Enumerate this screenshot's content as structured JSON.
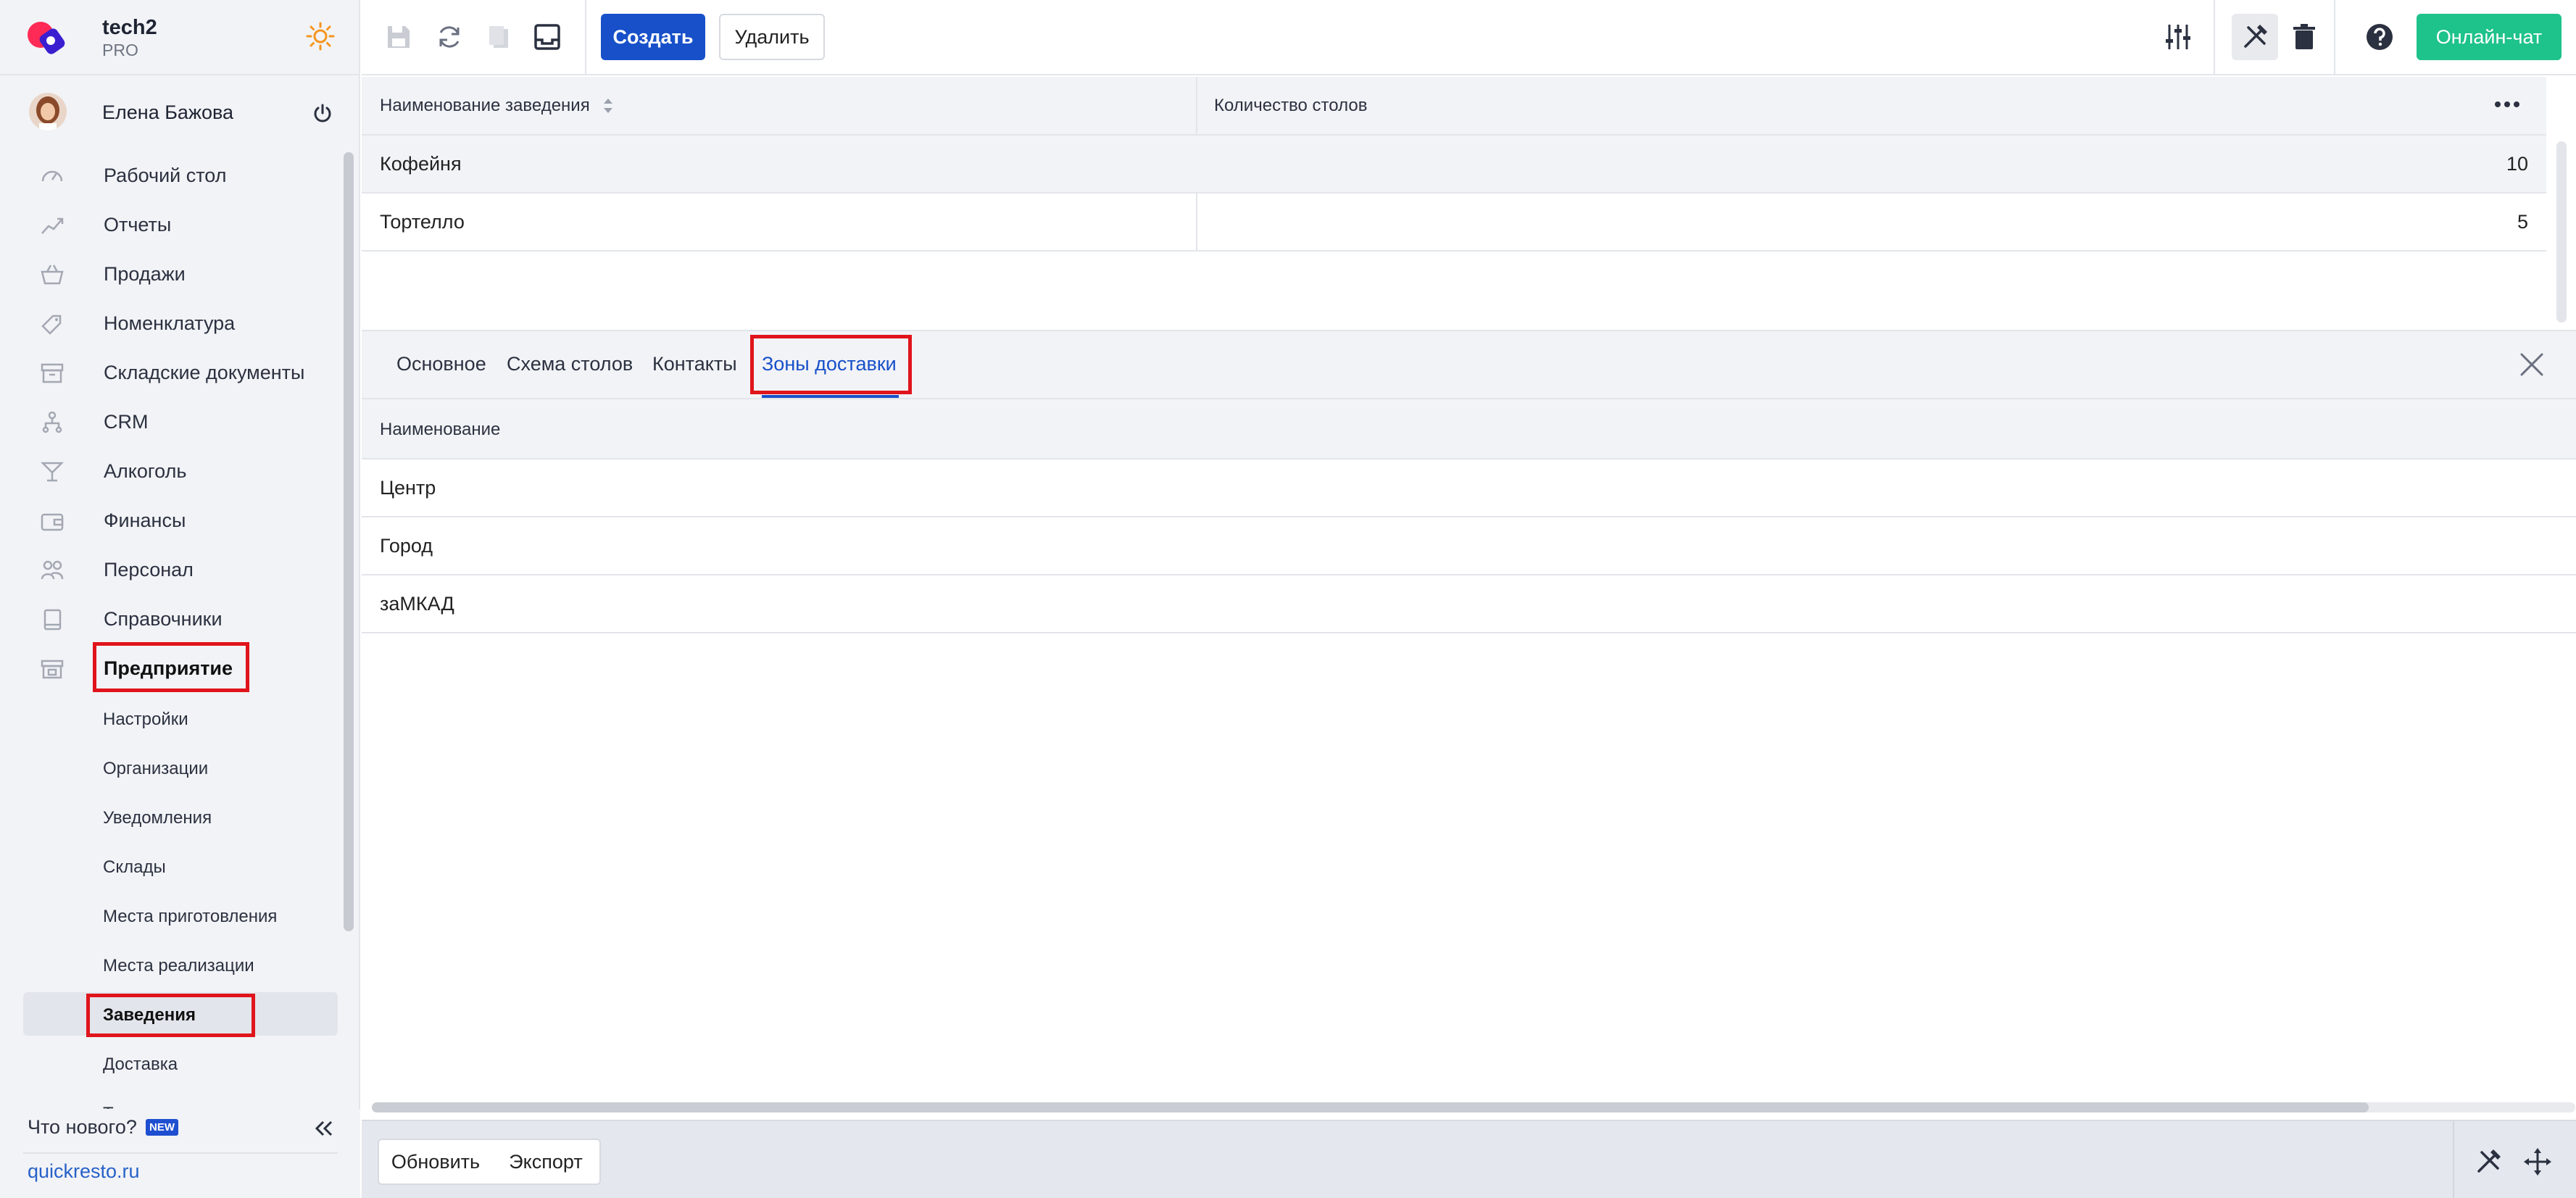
{
  "app": {
    "name": "tech2",
    "plan": "PRO",
    "user_name": "Елена Бажова"
  },
  "sidebar": {
    "items": [
      {
        "label": "Рабочий стол",
        "icon": "speedometer-icon"
      },
      {
        "label": "Отчеты",
        "icon": "chart-line-icon"
      },
      {
        "label": "Продажи",
        "icon": "basket-icon"
      },
      {
        "label": "Номенклатура",
        "icon": "tag-icon"
      },
      {
        "label": "Складские документы",
        "icon": "archive-box-icon"
      },
      {
        "label": "CRM",
        "icon": "people-hierarchy-icon"
      },
      {
        "label": "Алкоголь",
        "icon": "cocktail-glass-icon"
      },
      {
        "label": "Финансы",
        "icon": "wallet-icon"
      },
      {
        "label": "Персонал",
        "icon": "staff-icon"
      },
      {
        "label": "Справочники",
        "icon": "book-icon"
      },
      {
        "label": "Предприятие",
        "icon": "storefront-icon",
        "expanded": true
      }
    ],
    "subitems": [
      {
        "label": "Настройки"
      },
      {
        "label": "Организации"
      },
      {
        "label": "Уведомления"
      },
      {
        "label": "Склады"
      },
      {
        "label": "Места приготовления"
      },
      {
        "label": "Места реализации"
      },
      {
        "label": "Заведения",
        "selected": true
      },
      {
        "label": "Доставка"
      },
      {
        "label": "Терминалы"
      }
    ],
    "whats_new": "Что нового?",
    "new_badge": "NEW",
    "site_link": "quickresto.ru"
  },
  "toolbar": {
    "create_label": "Создать",
    "delete_label": "Удалить",
    "chat_label": "Онлайн-чат"
  },
  "main_table": {
    "columns": [
      "Наименование заведения",
      "Количество столов"
    ],
    "rows": [
      {
        "name": "Кофейня",
        "tables": "10"
      },
      {
        "name": "Тортелло",
        "tables": "5"
      }
    ]
  },
  "detail": {
    "tabs": [
      "Основное",
      "Схема столов",
      "Контакты",
      "Зоны доставки"
    ],
    "active_tab": "Зоны доставки",
    "column": "Наименование",
    "rows": [
      "Центр",
      "Город",
      "заМКАД"
    ]
  },
  "footer": {
    "refresh_label": "Обновить",
    "export_label": "Экспорт"
  },
  "colors": {
    "accent": "#1750c9",
    "chat": "#1ec28b",
    "highlight": "#e0141b"
  }
}
